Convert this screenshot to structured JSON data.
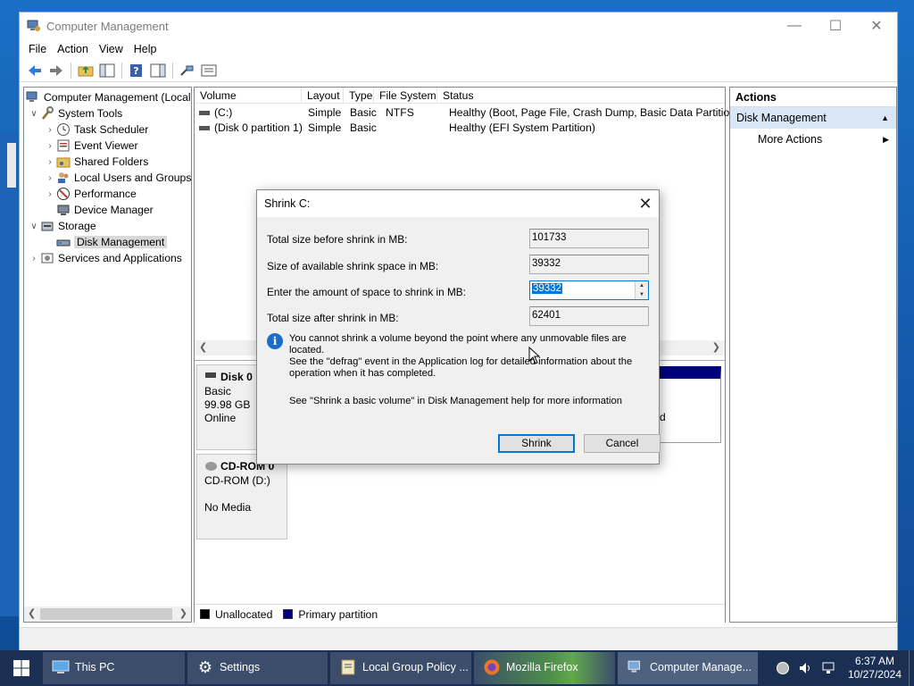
{
  "window": {
    "title": "Computer Management"
  },
  "menu": [
    "File",
    "Action",
    "View",
    "Help"
  ],
  "tree": {
    "root": "Computer Management (Local",
    "system_tools": "System Tools",
    "task_scheduler": "Task Scheduler",
    "event_viewer": "Event Viewer",
    "shared_folders": "Shared Folders",
    "local_users": "Local Users and Groups",
    "performance": "Performance",
    "device_manager": "Device Manager",
    "storage": "Storage",
    "disk_management": "Disk Management",
    "services": "Services and Applications"
  },
  "volumes": {
    "headers": [
      "Volume",
      "Layout",
      "Type",
      "File System",
      "Status"
    ],
    "rows": [
      [
        "(C:)",
        "Simple",
        "Basic",
        "NTFS",
        "Healthy (Boot, Page File, Crash Dump, Basic Data Partition)"
      ],
      [
        "(Disk 0 partition 1)",
        "Simple",
        "Basic",
        "",
        "Healthy (EFI System Partition)"
      ]
    ]
  },
  "disks": {
    "disk0": {
      "name": "Disk 0",
      "type": "Basic",
      "size": "99.98 GB",
      "status": "Online",
      "partial_text": "d"
    },
    "cdrom": {
      "name": "CD-ROM 0",
      "type": "CD-ROM (D:)",
      "status": "No Media"
    }
  },
  "legend": {
    "unallocated": "Unallocated",
    "primary": "Primary partition",
    "unallocated_color": "#000000",
    "primary_color": "#00007f"
  },
  "actions": {
    "header": "Actions",
    "section": "Disk Management",
    "more": "More Actions"
  },
  "dialog": {
    "title": "Shrink C:",
    "total_before_label": "Total size before shrink in MB:",
    "total_before_value": "101733",
    "available_label": "Size of available shrink space in MB:",
    "available_value": "39332",
    "amount_label": "Enter the amount of space to shrink in MB:",
    "amount_value": "39332",
    "total_after_label": "Total size after shrink in MB:",
    "total_after_value": "62401",
    "note_line1": "You cannot shrink a volume beyond the point where any unmovable files are located.",
    "note_line2": "See the \"defrag\" event in the Application log for detailed information about the",
    "note_line3": "operation when it has completed.",
    "help_text": "See \"Shrink a basic volume\" in Disk Management help for more information",
    "shrink_label": "Shrink",
    "cancel_label": "Cancel"
  },
  "taskbar": {
    "items": [
      "This PC",
      "Settings",
      "Local Group Policy ...",
      "Mozilla Firefox",
      "Computer Manage..."
    ],
    "time": "6:37 AM",
    "date": "10/27/2024"
  }
}
